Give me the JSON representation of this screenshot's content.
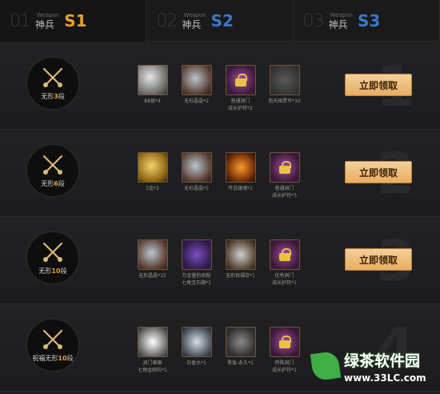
{
  "tabs": [
    {
      "num": "01",
      "sub": "Weapon",
      "cn": "神兵",
      "code": "S1",
      "active": true
    },
    {
      "num": "02",
      "sub": "Weapon",
      "cn": "神兵",
      "code": "S2",
      "active": false
    },
    {
      "num": "03",
      "sub": "Weapon",
      "cn": "神兵",
      "code": "S3",
      "active": false
    }
  ],
  "claim_label": "立即领取",
  "rows": [
    {
      "level_prefix": "无形",
      "level_num": "3",
      "level_suffix": "段",
      "watermark_digit": "1",
      "items": [
        {
          "icon": "silver-icon",
          "caption": "88银*4"
        },
        {
          "icon": "crystal-icon",
          "caption": "无形晶晶*2"
        },
        {
          "icon": "lock-icon",
          "caption": "普通洞门\n成长护符*2"
        },
        {
          "icon": "coin-icon",
          "caption": "南天国票币*10"
        }
      ]
    },
    {
      "level_prefix": "无形",
      "level_num": "6",
      "level_suffix": "段",
      "watermark_digit": "2",
      "items": [
        {
          "icon": "gold-icon",
          "caption": "3金*2"
        },
        {
          "icon": "crystal-icon",
          "caption": "无形晶晶*5"
        },
        {
          "icon": "fire-icon",
          "caption": "传说蕴魂*1"
        },
        {
          "icon": "lock-icon",
          "caption": "普通洞门\n成长护符*3"
        }
      ]
    },
    {
      "level_prefix": "无形",
      "level_num": "10",
      "level_suffix": "段",
      "watermark_digit": "3",
      "items": [
        {
          "icon": "crystal-icon",
          "caption": "无形晶晶*15"
        },
        {
          "icon": "box-icon",
          "caption": "万金量的祝粉\n七角宝石箱*1"
        },
        {
          "icon": "bottle-icon",
          "caption": "无形祝福饮*1"
        },
        {
          "icon": "lock-icon",
          "caption": "优秀洞门\n成长护符*1"
        }
      ]
    },
    {
      "level_prefix": "祝福无形",
      "level_num": "10",
      "level_suffix": "段",
      "watermark_digit": "4",
      "items": [
        {
          "icon": "gem-white-icon",
          "caption": "洞门章眼\n七角金刚石*1"
        },
        {
          "icon": "water-icon",
          "caption": "白香水*1"
        },
        {
          "icon": "beast-icon",
          "caption": "黑兔-永久*1"
        },
        {
          "icon": "lock-icon",
          "caption": "特殊洞门\n成长护符*1"
        }
      ]
    }
  ],
  "watermark": {
    "title": "绿茶软件园",
    "url": "www.33LC.com"
  }
}
